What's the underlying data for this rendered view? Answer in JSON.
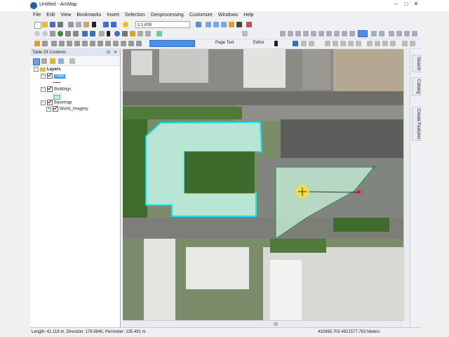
{
  "window": {
    "title": "Untitled - ArcMap"
  },
  "menu": [
    "File",
    "Edit",
    "View",
    "Bookmarks",
    "Insert",
    "Selection",
    "Geoprocessing",
    "Customize",
    "Windows",
    "Help"
  ],
  "toolbar": {
    "scale_value": "1:1,009",
    "page_text_label": "Page Text",
    "editor_label": "Editor"
  },
  "toc": {
    "title": "Table Of Contents",
    "root": "Layers",
    "layers": [
      {
        "name": "Path",
        "checked": true
      },
      {
        "name": "Buildings",
        "checked": true
      },
      {
        "name": "Basemap",
        "checked": true
      },
      {
        "name": "World_Imagery",
        "checked": true
      }
    ]
  },
  "dock": {
    "tabs": [
      "Search",
      "Catalog",
      "Create Features"
    ]
  },
  "status": {
    "measure": "Length: 41.119 m, Direction: 178.8840, Perimeter: 235.491 m",
    "coords": "432665.703  4621577.763 Meters"
  },
  "colors": {
    "accent": "#4d8fe6",
    "feature_fill": "#bfeee0",
    "feature_edge": "#19e0f0",
    "sketch_fill": "#c4ecd6"
  },
  "icons": [
    "arcmap-icon",
    "new-icon",
    "open-icon",
    "save-icon",
    "print-icon",
    "cut-icon",
    "copy-icon",
    "paste-icon",
    "delete-icon",
    "undo-icon",
    "redo-icon",
    "add-data-icon",
    "zoom-in-icon",
    "zoom-out-icon",
    "pan-icon",
    "full-extent-icon",
    "identify-icon",
    "select-icon",
    "find-icon",
    "measure-icon",
    "edit-tool-icon",
    "sketch-icon"
  ]
}
